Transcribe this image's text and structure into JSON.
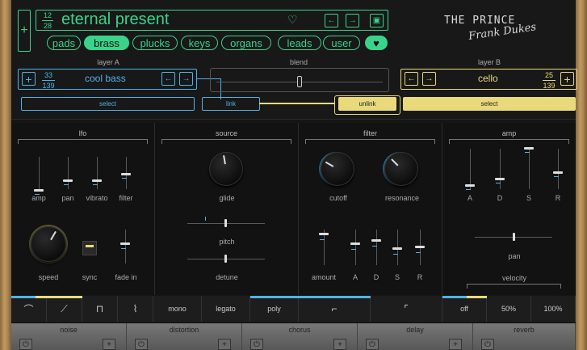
{
  "preset": {
    "index": "12",
    "total": "28",
    "name": "eternal present"
  },
  "categories": [
    "pads",
    "brass",
    "plucks",
    "keys",
    "organs",
    "leads"
  ],
  "user_label": "user",
  "logo": {
    "title": "THE PRINCE",
    "signature": "Frank Dukes"
  },
  "layer_a": {
    "label": "layer A",
    "index": "33",
    "total": "139",
    "name": "cool bass",
    "select": "select",
    "link": "link"
  },
  "blend": {
    "label": "blend",
    "value": 0.5
  },
  "layer_b": {
    "label": "layer B",
    "index": "25",
    "total": "139",
    "name": "cello",
    "select": "select",
    "unlink": "unlink"
  },
  "lfo": {
    "title": "lfo",
    "sliders": [
      "amp",
      "pan",
      "vibrato",
      "filter"
    ],
    "speed": "speed",
    "sync": "sync",
    "fade": "fade in"
  },
  "source": {
    "title": "source",
    "glide": "glide",
    "pitch": "pitch",
    "detune": "detune"
  },
  "filter": {
    "title": "filter",
    "cutoff": "cutoff",
    "resonance": "resonance",
    "env": [
      "amount",
      "A",
      "D",
      "S",
      "R"
    ]
  },
  "amp": {
    "title": "amp",
    "env": [
      "A",
      "D",
      "S",
      "R"
    ],
    "pan": "pan",
    "velocity": "velocity"
  },
  "bottom": {
    "modes": [
      "mono",
      "legato",
      "poly"
    ],
    "velocity": [
      "off",
      "50%",
      "100%"
    ]
  },
  "effects": [
    "noise",
    "distortion",
    "chorus",
    "delay",
    "reverb"
  ],
  "colors": {
    "green": "#3ad38a",
    "blue": "#4fb3e6",
    "yellow": "#e8da7a"
  }
}
